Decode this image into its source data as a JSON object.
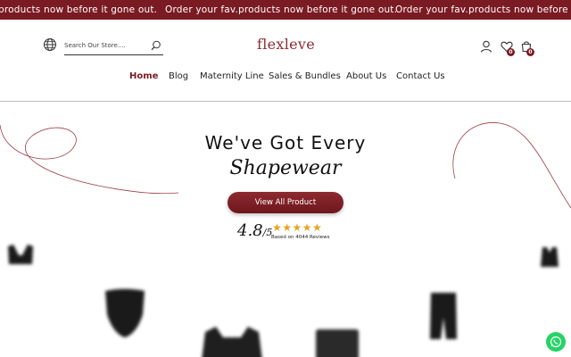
{
  "announcement": {
    "segments": [
      "products now before it gone out.",
      "Order your fav.products now before it gone out.",
      "Order your fav.products now before it gone o"
    ]
  },
  "header": {
    "search_placeholder": "Search Our Store....",
    "logo_text": "flexleve",
    "wishlist_count": "0",
    "cart_count": "0"
  },
  "nav": {
    "items": [
      {
        "label": "Home"
      },
      {
        "label": "Blog"
      },
      {
        "label": "Maternity Line"
      },
      {
        "label": "Sales & Bundles"
      },
      {
        "label": "About Us"
      },
      {
        "label": "Contact Us"
      }
    ]
  },
  "hero": {
    "title": "We've Got Every",
    "subtitle": "Shapewear",
    "cta_label": "View All Product",
    "rating": "4.8",
    "rating_max": "/5",
    "stars": "★★★★★",
    "reviews_text": "Based on 4044 Reviews"
  },
  "colors": {
    "brand": "#7a1a22",
    "star": "#e6a520",
    "whatsapp": "#25d366"
  },
  "icons": [
    "globe-icon",
    "search-icon",
    "user-icon",
    "heart-icon",
    "cart-icon",
    "whatsapp-icon"
  ]
}
